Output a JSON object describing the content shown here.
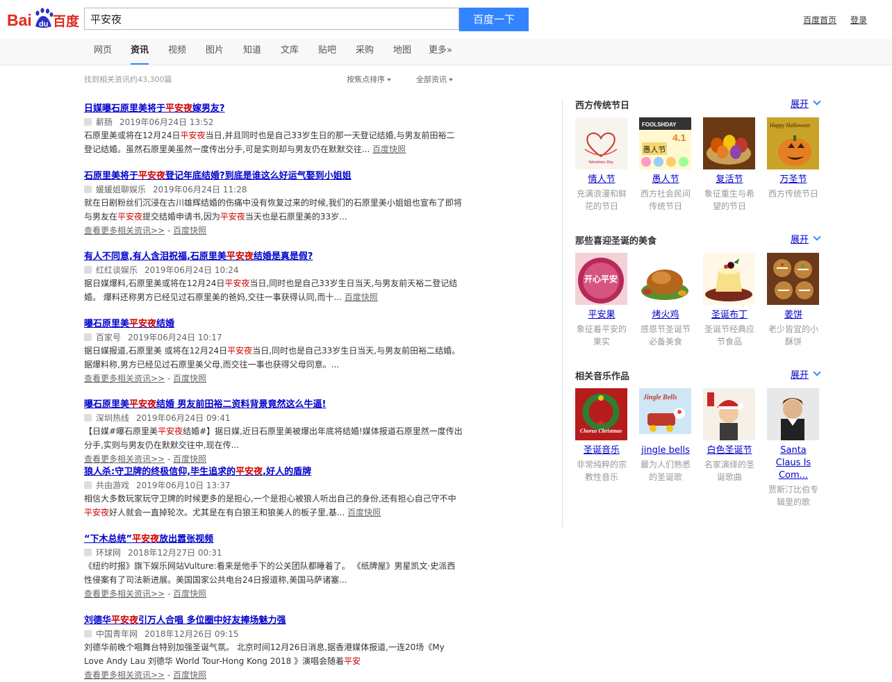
{
  "header": {
    "logo_text_en": "Bai",
    "logo_du": "du",
    "logo_text_cn": "百度",
    "search_value": "平安夜",
    "search_button": "百度一下",
    "links": [
      "百度首页",
      "登录"
    ]
  },
  "nav": {
    "tabs": [
      "网页",
      "资讯",
      "视频",
      "图片",
      "知道",
      "文库",
      "贴吧",
      "采购",
      "地图",
      "更多»"
    ],
    "active": "资讯"
  },
  "toolbar": {
    "result_count": "找到相关资讯约43,300篇",
    "sort": "按焦点排序",
    "filter": "全部资讯"
  },
  "results": [
    {
      "title": [
        [
          "日媒曝石原里美将于",
          false
        ],
        [
          "平安夜",
          true
        ],
        [
          "嫁男友?",
          false
        ]
      ],
      "source": "薪肠",
      "date": "2019年06月24日 13:52",
      "abstract": [
        [
          "石原里美或将在12月24日",
          false
        ],
        [
          "平安夜",
          true
        ],
        [
          "当日,并且同时也是自己33岁生日的那一天登记结婚,与男友前田裕二登记结婚。虽然石原里美虽然一度传出分手,可是实则却与男友仍在默默交往...",
          false
        ]
      ],
      "snapshot": "百度快照"
    },
    {
      "title": [
        [
          "石原里美将于",
          false
        ],
        [
          "平安夜",
          true
        ],
        [
          "登记年底结婚?到底是谁这么好运气娶到小姐姐",
          false
        ]
      ],
      "source": "媛媛姐聊娱乐",
      "date": "2019年06月24日 11:28",
      "abstract": [
        [
          "就在日剧粉丝们沉浸在古川雄辉结婚的伤痛中没有恢复过来的时候,我们的石原里美小姐姐也宣布了即将与男友在",
          false
        ],
        [
          "平安夜",
          true
        ],
        [
          "提交结婚申请书,因为",
          false
        ],
        [
          "平安夜",
          true
        ],
        [
          "当天也是石原里美的33岁...",
          false
        ]
      ],
      "more": "查看更多相关资讯>>",
      "snapshot": "百度快照"
    },
    {
      "title": [
        [
          "有人不同意,有人含泪祝福,石原里美",
          false
        ],
        [
          "平安夜",
          true
        ],
        [
          "结婚是真是假?",
          false
        ]
      ],
      "source": "红红谈娱乐",
      "date": "2019年06月24日 10:24",
      "abstract": [
        [
          "据日媒爆料,石原里美或将在12月24日",
          false
        ],
        [
          "平安夜",
          true
        ],
        [
          "当日,同时也是自己33岁生日当天,与男友前天裕二登记结婚。 爆料还称男方已经见过石原里美的爸妈,交往一事获得认同,而十...",
          false
        ]
      ],
      "snapshot": "百度快照"
    },
    {
      "title": [
        [
          "曝石原里美",
          false
        ],
        [
          "平安夜",
          true
        ],
        [
          "结婚",
          false
        ]
      ],
      "source": "百家号",
      "date": "2019年06月24日 10:17",
      "abstract": [
        [
          "据日媒报道,石原里美 或将在12月24日",
          false
        ],
        [
          "平安夜",
          true
        ],
        [
          "当日,同时也是自己33岁生日当天,与男友前田裕二结婚。据爆料称,男方已经见过石原里美父母,而交往一事也获得父母同意。...",
          false
        ]
      ],
      "more": "查看更多相关资讯>>",
      "snapshot": "百度快照"
    },
    {
      "title": [
        [
          "曝石原里美",
          false
        ],
        [
          "平安夜",
          true
        ],
        [
          "结婚 男友前田裕二资料背景竟然这么牛逼!",
          false
        ]
      ],
      "source": "深圳热线",
      "date": "2019年06月24日 09:41",
      "abstract": [
        [
          "【日媒#曝石原里美",
          false
        ],
        [
          "平安夜",
          true
        ],
        [
          "结婚#】据日媒,近日石原里美被爆出年底将结婚!媒体报道石原里然一度传出分手,实则与男友仍在默默交往中,现在传...",
          false
        ]
      ],
      "more": "查看更多相关资讯>>",
      "snapshot": "百度快照"
    },
    {
      "title": [
        [
          "狼人杀:守卫牌的终极信仰,毕生追求的",
          false
        ],
        [
          "平安夜",
          true
        ],
        [
          ",好人的盾牌",
          false
        ]
      ],
      "source": "共由游戏",
      "date": "2019年06月10日 13:37",
      "abstract": [
        [
          "相信大多数玩家玩守卫牌的时候更多的是担心,一个是担心被狼人听出自己的身份,还有担心自己守不中",
          false
        ],
        [
          "平安夜",
          true
        ],
        [
          "好人就会一直掉轮次。尤其是在有白狼王和狼美人的板子里,基...",
          false
        ]
      ],
      "snapshot": "百度快照"
    },
    {
      "title": [
        [
          "“下木总统”",
          false
        ],
        [
          "平安夜",
          true
        ],
        [
          "放出嚣张视频",
          false
        ]
      ],
      "source": "环球网",
      "date": "2018年12月27日 00:31",
      "abstract": [
        [
          "《纽约时报》旗下娱乐网站Vulture:看来是他手下的公关团队都睡着了。 《纸牌屋》男星凯文·史派西性侵案有了司法新进展。美国国家公共电台24日报道称,美国马萨诸塞...",
          false
        ]
      ],
      "more": "查看更多相关资讯>>",
      "snapshot": "百度快照"
    },
    {
      "title": [
        [
          "刘德华",
          false
        ],
        [
          "平安夜",
          true
        ],
        [
          "引万人合唱 多位圈中好友捧场魅力强",
          false
        ]
      ],
      "source": "中国青年网",
      "date": "2018年12月26日 09:15",
      "abstract": [
        [
          "刘德华前晚个唱舞台特别加强圣诞气氛。 北京时间12月26日消息,据香港媒体报道,一连20场《My Love Andy Lau 刘德华 World Tour-Hong Kong 2018 》演唱会随着",
          false
        ],
        [
          "平安",
          true
        ]
      ],
      "more": "查看更多相关资讯>>",
      "snapshot": "百度快照"
    }
  ],
  "sidebar": [
    {
      "title": "西方传统节日",
      "expand": "展开",
      "cards": [
        {
          "name": "情人节",
          "desc": "充满浪漫和鲜花的节日"
        },
        {
          "name": "愚人节",
          "desc": "西方社会民间传统节日"
        },
        {
          "name": "复活节",
          "desc": "象征重生与希望的节日"
        },
        {
          "name": "万圣节",
          "desc": "西方传统节日"
        }
      ]
    },
    {
      "title": "那些喜迎圣诞的美食",
      "expand": "展开",
      "cards": [
        {
          "name": "平安果",
          "desc": "象征着平安的果实"
        },
        {
          "name": "烤火鸡",
          "desc": "感恩节圣诞节必备美食"
        },
        {
          "name": "圣诞布丁",
          "desc": "圣诞节经典应节食品"
        },
        {
          "name": "姜饼",
          "desc": "老少皆宜的小酥饼"
        }
      ]
    },
    {
      "title": "相关音乐作品",
      "expand": "展开",
      "cards": [
        {
          "name": "圣诞音乐",
          "desc": "非常纯粹的宗教性音乐"
        },
        {
          "name": "jingle bells",
          "desc": "最为人们熟悉的圣诞歌"
        },
        {
          "name": "白色圣诞节",
          "desc": "名家演绎的圣诞歌曲"
        },
        {
          "name": "Santa Claus Is Com...",
          "desc": "贾斯汀比伯专辑里的歌"
        }
      ]
    }
  ],
  "thumb_text": {
    "valentine": "Valentines Day",
    "april_en": "FOOLSHDAY",
    "april_num": "4.1",
    "april_cn": "愚人节",
    "halloween": "Happy Halloween",
    "apple": "开心平安",
    "xmas_card": "Chorus Christmas",
    "jingle": "Jingle Bells"
  },
  "colors": {
    "accent": "#3385ff",
    "link": "#0000cc",
    "highlight": "#cc0000"
  }
}
